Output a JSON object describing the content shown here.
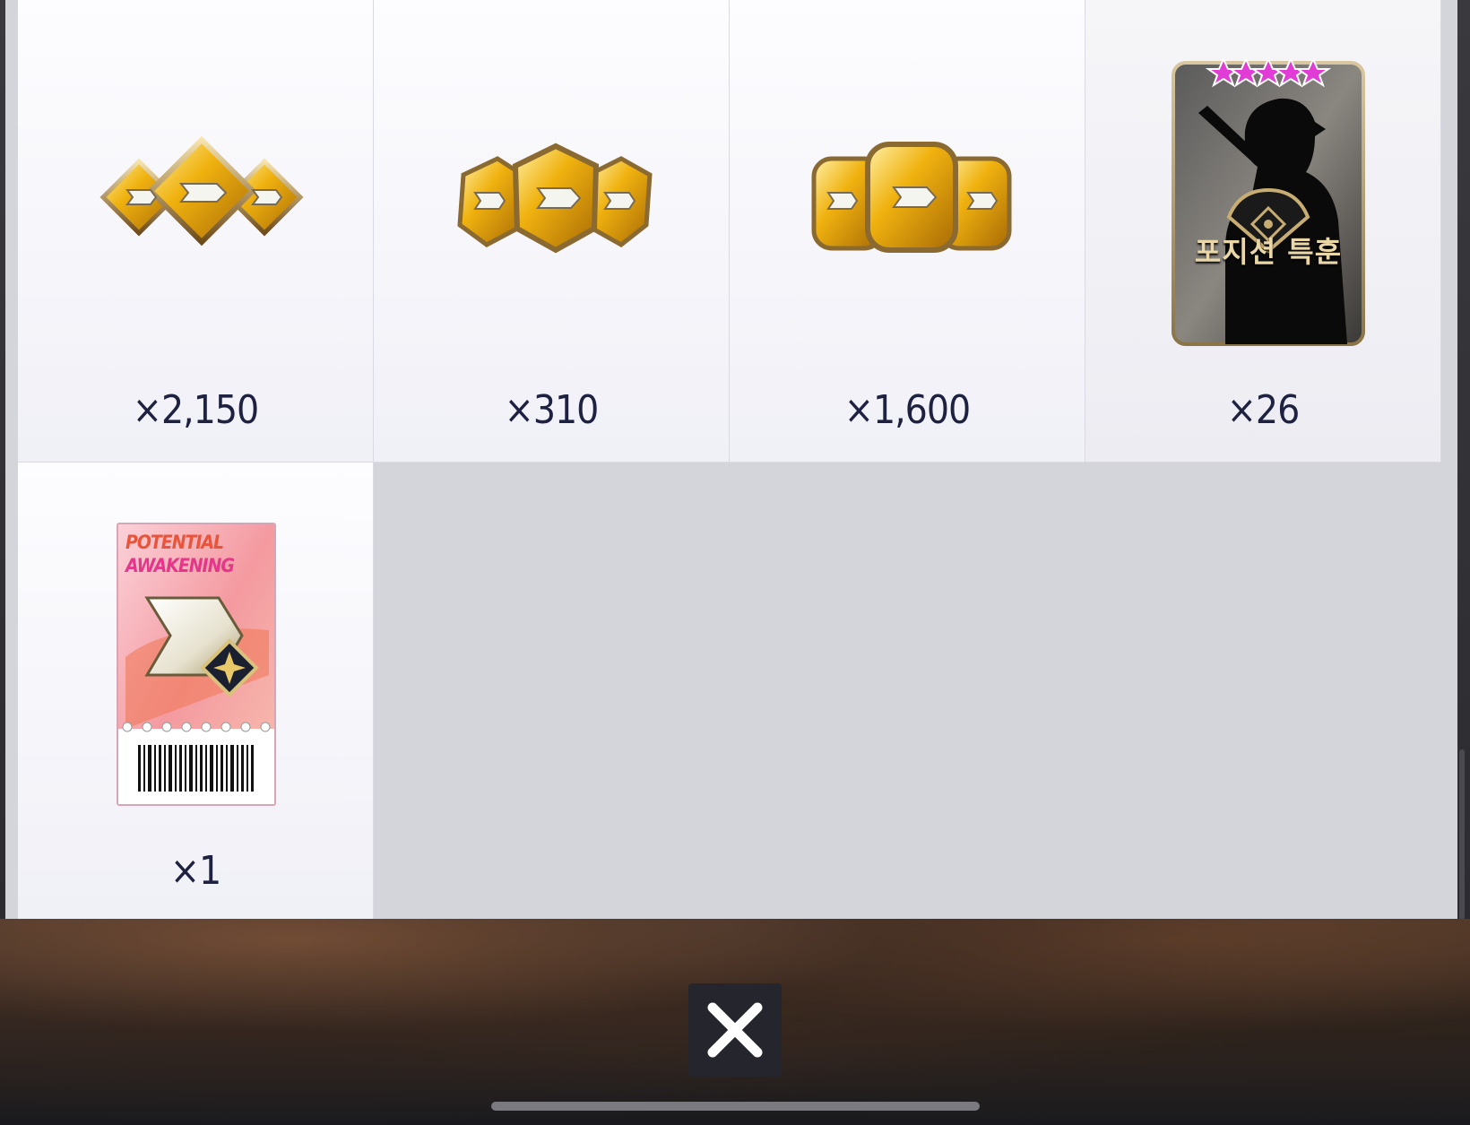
{
  "rewards": [
    {
      "id": "ticket-gold-diamond",
      "quantity": "×2,150"
    },
    {
      "id": "ticket-gold-hex",
      "quantity": "×310"
    },
    {
      "id": "ticket-gold-rounded",
      "quantity": "×1,600"
    },
    {
      "id": "position-training-card",
      "quantity": "×26",
      "card_text": "포지션 특훈"
    },
    {
      "id": "potential-awakening-ticket",
      "quantity": "×1",
      "ticket_title_line1": "POTENTIAL",
      "ticket_title_line2": "AWAKENING"
    }
  ],
  "close_button": {
    "icon": "close-icon",
    "label": ""
  },
  "colors": {
    "gold": "#e9a70d",
    "navy_text": "#1e2140",
    "panel_bg": "#d4d5da"
  }
}
